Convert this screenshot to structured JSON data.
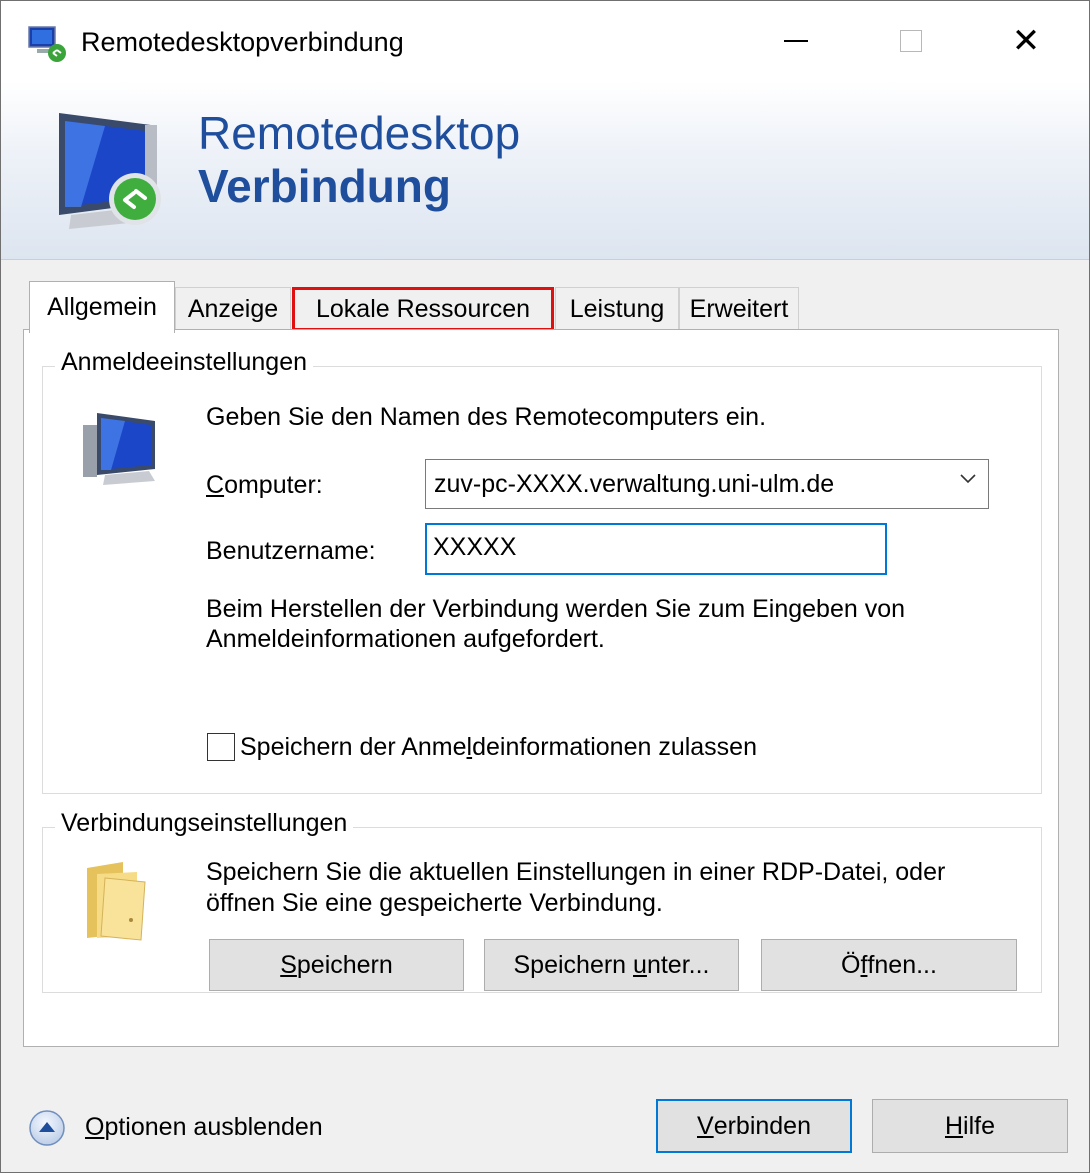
{
  "window": {
    "title": "Remotedesktopverbindung",
    "close_glyph": "✕"
  },
  "banner": {
    "line1": "Remotedesktop",
    "line2": "Verbindung"
  },
  "tabs": [
    {
      "label": "Allgemein",
      "active": true
    },
    {
      "label": "Anzeige"
    },
    {
      "label": "Lokale Ressourcen",
      "highlight_color": "#e01010"
    },
    {
      "label": "Leistung"
    },
    {
      "label": "Erweitert"
    }
  ],
  "logon": {
    "group_title": "Anmeldeeinstellungen",
    "instruction": "Geben Sie den Namen des Remotecomputers ein.",
    "computer_label_u": "C",
    "computer_label_rest": "omputer:",
    "computer_value": "zuv-pc-XXXX.verwaltung.uni-ulm.de",
    "username_label": "Benutzername:",
    "username_value": "XXXXX",
    "info_line1": "Beim Herstellen der Verbindung werden Sie zum Eingeben von",
    "info_line2": "Anmeldeinformationen aufgefordert.",
    "save_credentials_pre": "Speichern der Anme",
    "save_credentials_u": "l",
    "save_credentials_post": "deinformationen zulassen",
    "save_credentials_checked": false
  },
  "connection": {
    "group_title": "Verbindungseinstellungen",
    "text_line1": "Speichern Sie die aktuellen Einstellungen in einer RDP-Datei, oder",
    "text_line2": "öffnen Sie eine gespeicherte Verbindung.",
    "save_u": "S",
    "save_rest": "peichern",
    "save_as_pre": "Speichern ",
    "save_as_u": "u",
    "save_as_rest": "nter...",
    "open_pre": "Ö",
    "open_u": "f",
    "open_rest": "fnen..."
  },
  "footer": {
    "options_u": "O",
    "options_rest": "ptionen ausblenden",
    "connect_u": "V",
    "connect_rest": "erbinden",
    "help_u": "H",
    "help_rest": "ilfe"
  },
  "colors": {
    "accent": "#0078d7",
    "banner_text": "#1e4e9c",
    "highlight": "#e01010"
  },
  "icons": [
    "rdp-app-icon",
    "minimize-icon",
    "maximize-icon",
    "close-icon",
    "rdp-banner-icon",
    "computer-icon",
    "chevron-down-icon",
    "folder-icon",
    "collapse-up-icon"
  ]
}
